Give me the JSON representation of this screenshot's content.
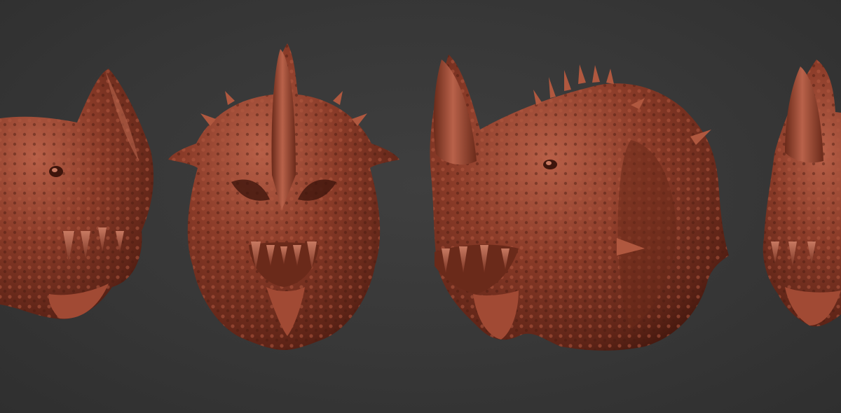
{
  "scene": {
    "background_color": "#3a3a3a",
    "material_color": "#8a3b28",
    "highlight_color": "#c8735a",
    "shadow_color": "#4a1a10",
    "subject": "sculpted-dragon-head",
    "views": [
      {
        "name": "side-profile-left",
        "visibility": "partial"
      },
      {
        "name": "front",
        "visibility": "full"
      },
      {
        "name": "three-quarter",
        "visibility": "full"
      },
      {
        "name": "side-profile-right",
        "visibility": "partial"
      }
    ]
  }
}
